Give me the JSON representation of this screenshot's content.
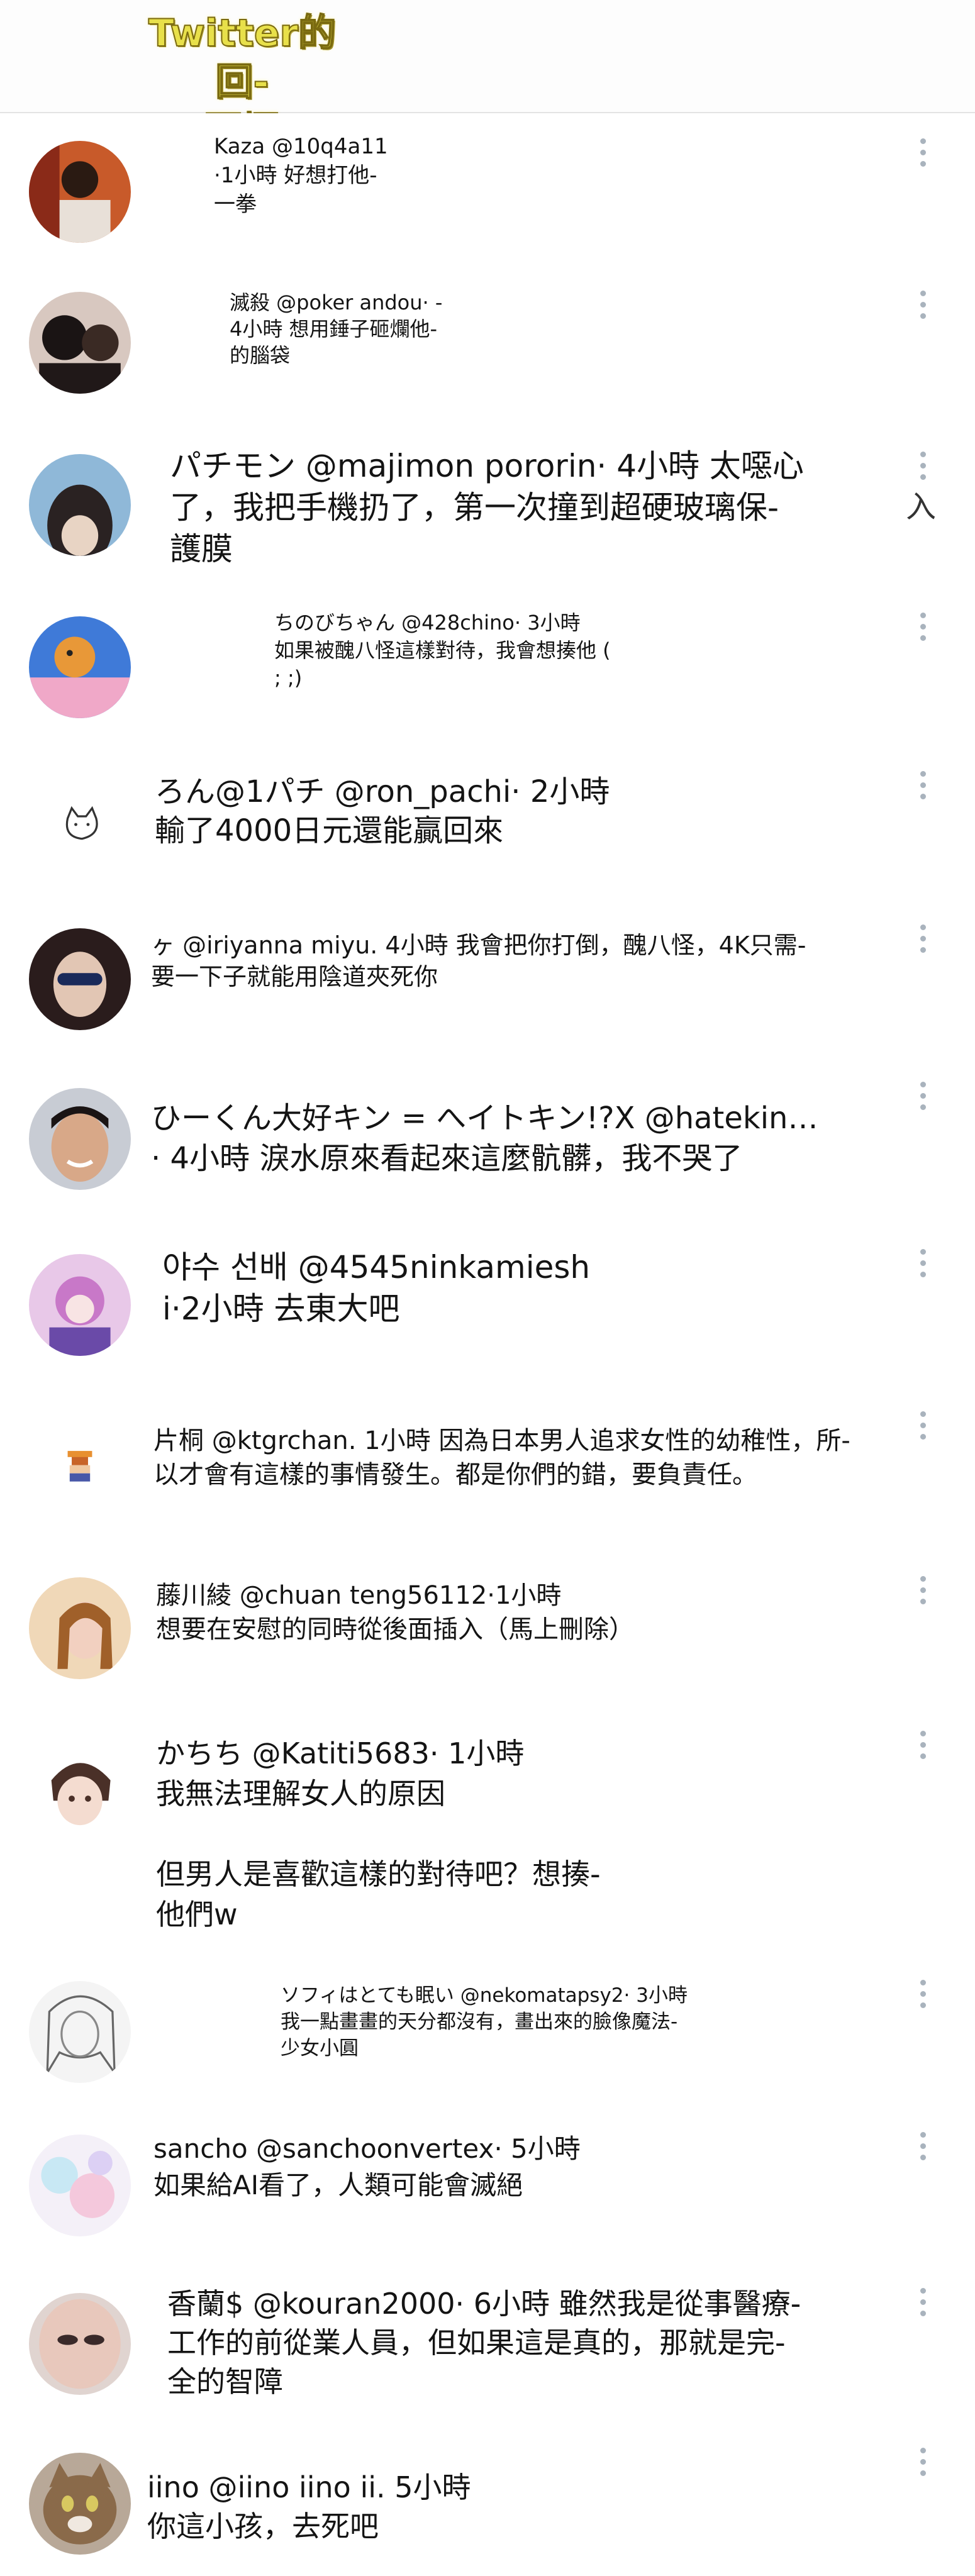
{
  "header": {
    "title_line1": "Twitter的回-",
    "title_line2": "覆欄"
  },
  "side_glyph": "入",
  "replies": [
    {
      "text": "Kaza @10q4a11\n·1小時 好想打他-\n一拳",
      "avatar_icon": "user-photo-avatar"
    },
    {
      "text": "滅殺 @poker andou· -\n4小時 想用錘子砸爛他-\n的腦袋",
      "avatar_icon": "user-photo-avatar"
    },
    {
      "text": "パチモン @majimon pororin· 4小時 太噁心\n了，我把手機扔了，第一次撞到超硬玻璃保-\n護膜",
      "avatar_icon": "user-photo-avatar"
    },
    {
      "text": "ちのびちゃん @428chino· 3小時\n如果被醜八怪這樣對待，我會想揍他 (\n; ;)",
      "avatar_icon": "cartoon-avatar"
    },
    {
      "text": "ろん@1パチ @ron_pachi· 2小時\n輸了4000日元還能贏回來",
      "avatar_icon": "cat-doodle-avatar"
    },
    {
      "text": "ヶ @iriyanna miyu. 4小時 我會把你打倒，醜八怪，4K只需-\n要一下子就能用陰道夾死你",
      "avatar_icon": "user-photo-avatar"
    },
    {
      "text": "ひーくん大好キン = へイトキン!?X @hatekin…\n· 4小時 淚水原來看起來這麼骯髒，我不哭了",
      "avatar_icon": "user-photo-avatar"
    },
    {
      "text": "야수 선배 @4545ninkamiesh\ni·2小時 去東大吧",
      "avatar_icon": "anime-avatar"
    },
    {
      "text": "片桐 @ktgrchan. 1小時 因為日本男人追求女性的幼稚性，所-\n以才會有這樣的事情發生。都是你們的錯，要負責任。",
      "avatar_icon": "pixel-character-avatar"
    },
    {
      "text": "藤川綾 @chuan teng56112·1小時\n想要在安慰的同時從後面插入（馬上刪除）",
      "avatar_icon": "user-photo-avatar"
    },
    {
      "text": "かちち @Katiti5683· 1小時\n我無法理解女人的原因\n\n但男人是喜歡這樣的對待吧？想揍-\n他們w",
      "avatar_icon": "anime-avatar"
    },
    {
      "text": "ソフィはとても眠い @nekomatapsy2· 3小時\n我一點畫畫的天分都沒有，畫出來的臉像魔法-\n少女小圓",
      "avatar_icon": "sketch-avatar"
    },
    {
      "text": "sancho @sanchoonvertex· 5小時\n如果給AI看了，人類可能會滅絕",
      "avatar_icon": "pastel-art-avatar"
    },
    {
      "text": "香蘭$ @kouran2000· 6小時 雖然我是從事醫療-\n工作的前從業人員，但如果這是真的，那就是完-\n全的智障",
      "avatar_icon": "user-photo-avatar"
    },
    {
      "text": "iino @iino iino ii. 5小時\n你這小孩，去死吧",
      "avatar_icon": "cat-photo-avatar"
    }
  ]
}
